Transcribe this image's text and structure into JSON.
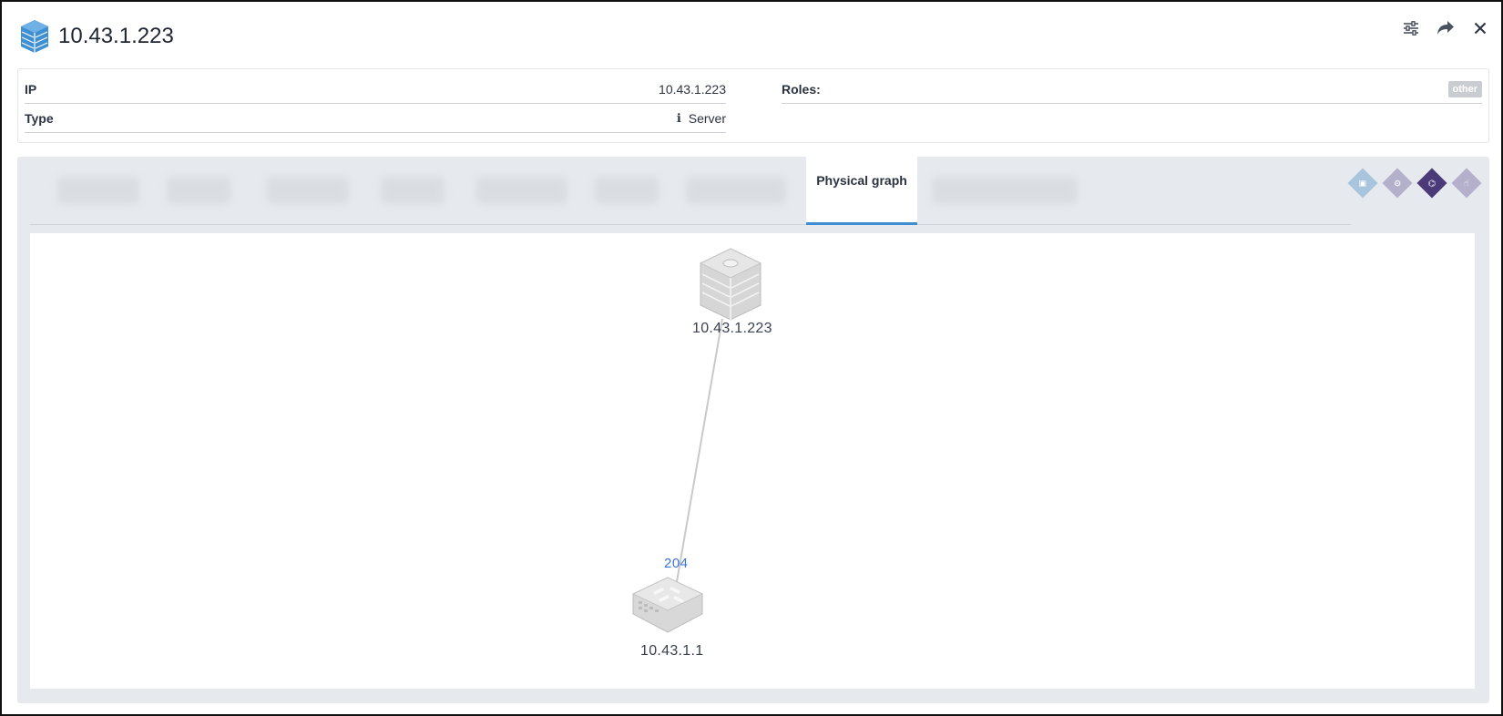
{
  "header": {
    "title": "10.43.1.223",
    "actions": {
      "filter_icon": "sliders-icon",
      "share_icon": "share-arrow-icon",
      "close_icon": "close-icon"
    }
  },
  "info": {
    "ip_label": "IP",
    "ip_value": "10.43.1.223",
    "type_label": "Type",
    "type_value": "Server",
    "roles_label": "Roles:",
    "roles_badge": "other"
  },
  "tabs": {
    "active_label": "Physical graph"
  },
  "graph": {
    "nodes": [
      {
        "label": "10.43.1.223",
        "icon": "server-icon"
      },
      {
        "label": "10.43.1.1",
        "icon": "switch-icon"
      }
    ],
    "edge_label": "204"
  },
  "colors": {
    "accent": "#3d8fd1",
    "edge_label": "#3d73d9",
    "mode_active": "#4b3a78",
    "mode_inactive": "#b4b0cc",
    "mode_light": "#a9c5dd"
  }
}
